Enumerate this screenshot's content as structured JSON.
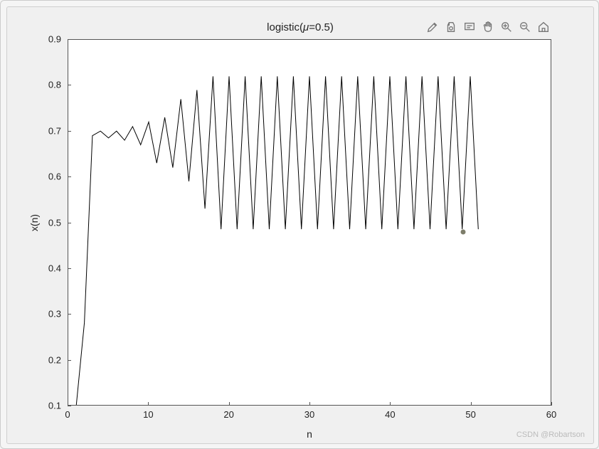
{
  "chart_data": {
    "type": "line",
    "title": "logistic(μ=0.5)",
    "xlabel": "n",
    "ylabel": "x(n)",
    "xlim": [
      0,
      60
    ],
    "ylim": [
      0.1,
      0.9
    ],
    "x": [
      1,
      2,
      3,
      4,
      5,
      6,
      7,
      8,
      9,
      10,
      11,
      12,
      13,
      14,
      15,
      16,
      17,
      18,
      19,
      20,
      21,
      22,
      23,
      24,
      25,
      26,
      27,
      28,
      29,
      30,
      31,
      32,
      33,
      34,
      35,
      36,
      37,
      38,
      39,
      40,
      41,
      42,
      43,
      44,
      45,
      46,
      47,
      48,
      49,
      50,
      51
    ],
    "y": [
      0.1,
      0.28,
      0.69,
      0.7,
      0.685,
      0.7,
      0.68,
      0.71,
      0.67,
      0.72,
      0.63,
      0.73,
      0.62,
      0.77,
      0.59,
      0.79,
      0.53,
      0.82,
      0.485,
      0.82,
      0.485,
      0.82,
      0.485,
      0.82,
      0.485,
      0.82,
      0.485,
      0.82,
      0.485,
      0.82,
      0.485,
      0.82,
      0.485,
      0.82,
      0.485,
      0.82,
      0.485,
      0.82,
      0.485,
      0.82,
      0.485,
      0.82,
      0.485,
      0.82,
      0.485,
      0.82,
      0.485,
      0.82,
      0.485,
      0.82,
      0.485
    ],
    "marker": {
      "x": 49,
      "y": 0.48
    },
    "xticks": [
      0,
      10,
      20,
      30,
      40,
      50,
      60
    ],
    "yticks": [
      0.1,
      0.2,
      0.3,
      0.4,
      0.5,
      0.6,
      0.7,
      0.8,
      0.9
    ]
  },
  "title_parts": {
    "pre": "logistic(",
    "mu": "μ",
    "post": "=0.5)"
  },
  "xlabel": "n",
  "ylabel": "x(n)",
  "watermark": "CSDN @Robartson",
  "xticks_labels": [
    "0",
    "10",
    "20",
    "30",
    "40",
    "50",
    "60"
  ],
  "yticks_labels": [
    "0.1",
    "0.2",
    "0.3",
    "0.4",
    "0.5",
    "0.6",
    "0.7",
    "0.8",
    "0.9"
  ],
  "toolbar_names": [
    "brush",
    "link",
    "datatip",
    "pan",
    "zoom-in",
    "zoom-out",
    "home"
  ]
}
